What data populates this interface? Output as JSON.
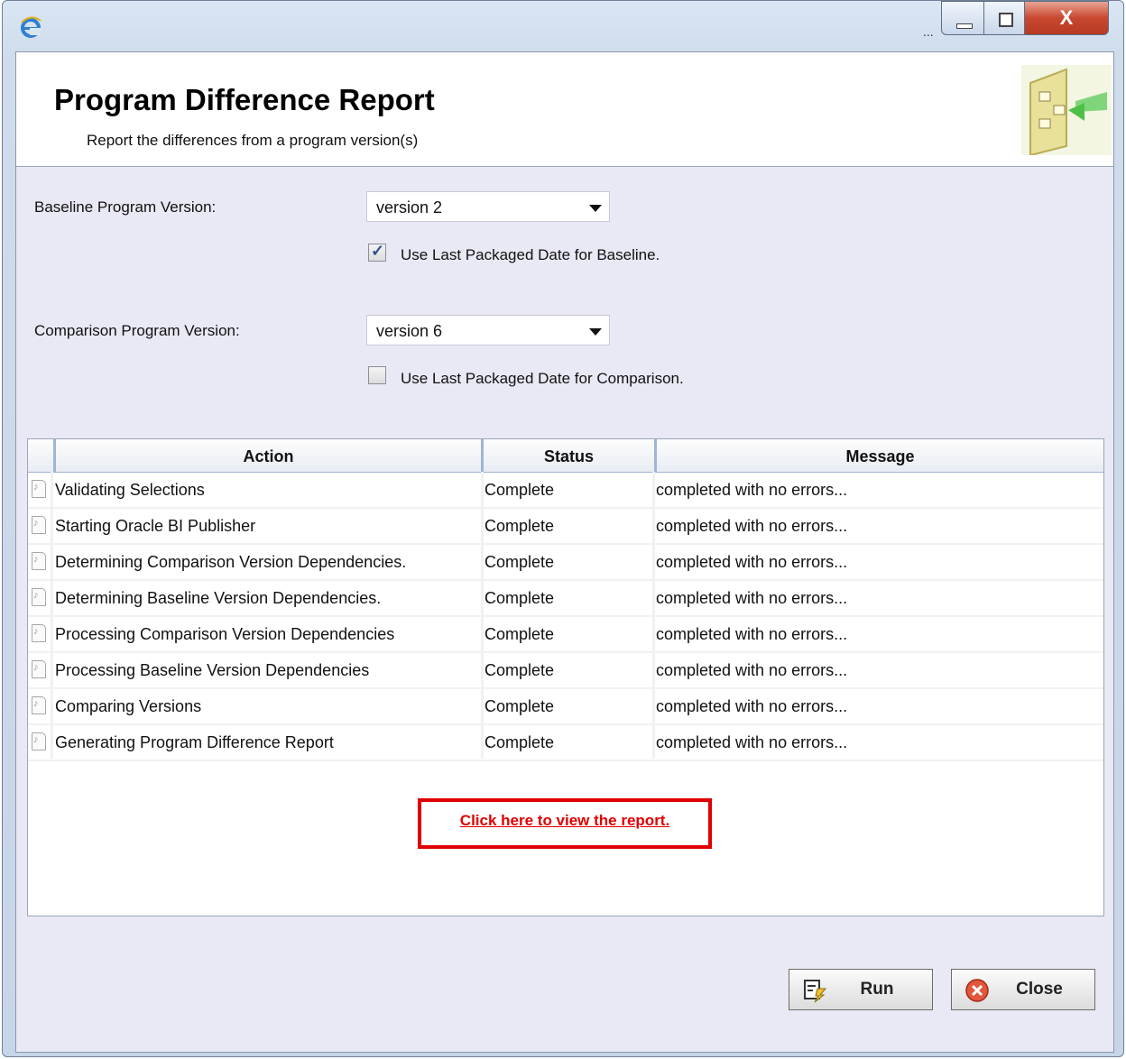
{
  "header": {
    "title": "Program Difference Report",
    "subtitle": "Report the differences from a program version(s)"
  },
  "window": {
    "close_glyph": "X",
    "ellipsis": "..."
  },
  "form": {
    "baseline_label": "Baseline Program Version:",
    "baseline_value": "version 2",
    "baseline_checkbox_label": "Use Last Packaged Date for Baseline.",
    "baseline_checked": true,
    "comparison_label": "Comparison Program Version:",
    "comparison_value": "version 6",
    "comparison_checkbox_label": "Use Last Packaged Date for Comparison.",
    "comparison_checked": false
  },
  "table": {
    "columns": [
      "Action",
      "Status",
      "Message"
    ],
    "rows": [
      {
        "action": "Validating Selections",
        "status": "Complete",
        "message": "completed with no errors..."
      },
      {
        "action": "Starting Oracle BI Publisher",
        "status": "Complete",
        "message": "completed with no errors..."
      },
      {
        "action": "Determining Comparison Version Dependencies.",
        "status": "Complete",
        "message": "completed with no errors..."
      },
      {
        "action": "Determining Baseline Version Dependencies.",
        "status": "Complete",
        "message": "completed with no errors..."
      },
      {
        "action": "Processing Comparison Version Dependencies",
        "status": "Complete",
        "message": "completed with no errors..."
      },
      {
        "action": "Processing Baseline Version Dependencies",
        "status": "Complete",
        "message": "completed with no errors..."
      },
      {
        "action": "Comparing Versions",
        "status": "Complete",
        "message": "completed with no errors..."
      },
      {
        "action": "Generating Program Difference Report",
        "status": "Complete",
        "message": "completed with no errors..."
      }
    ]
  },
  "report_link": "Click here to view the report.",
  "buttons": {
    "run": "Run",
    "close": "Close"
  },
  "colors": {
    "link": "#e00000",
    "panel_background": "#e9e9f5"
  }
}
